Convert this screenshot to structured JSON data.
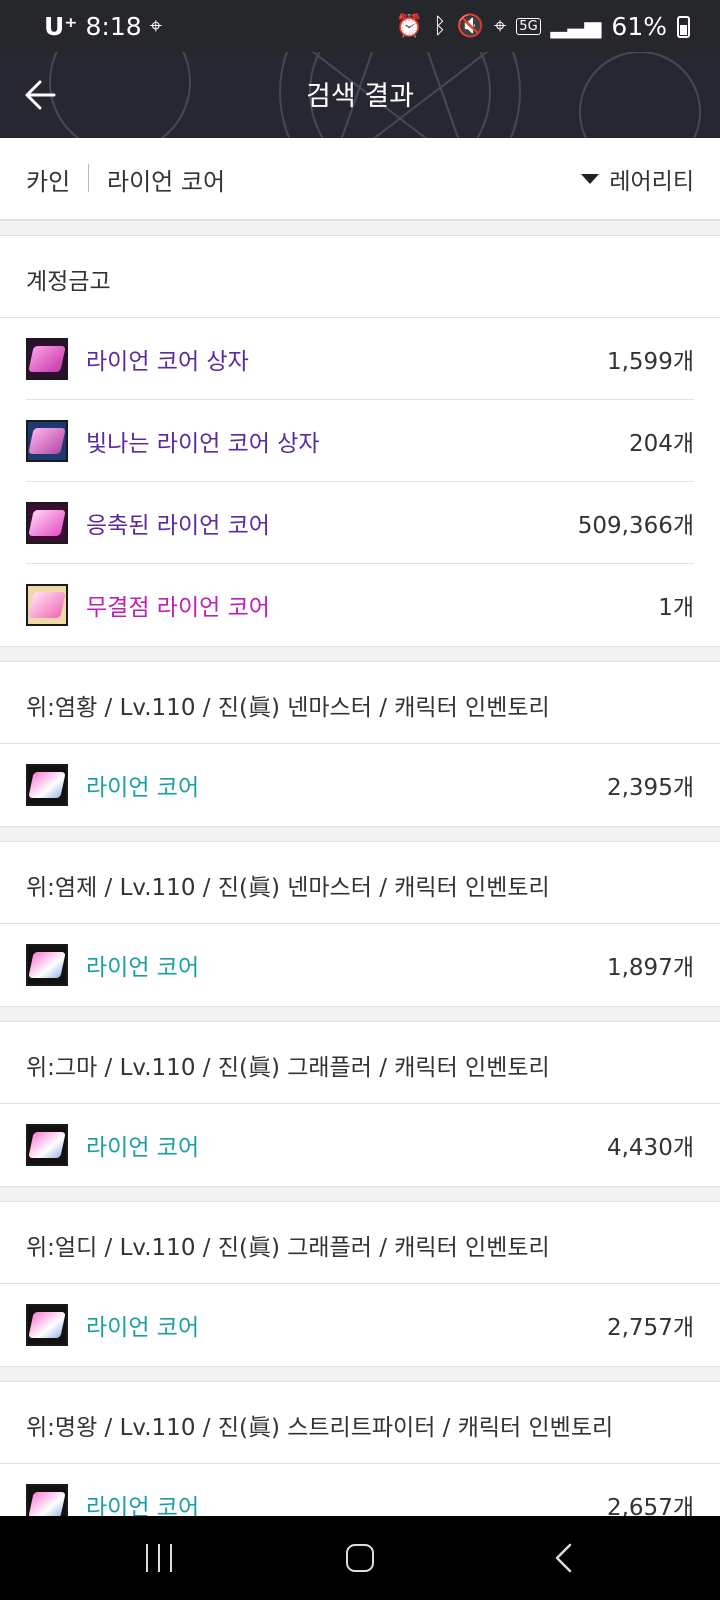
{
  "status_bar": {
    "carrier": "U⁺",
    "time": "8:18",
    "battery": "61%",
    "network": "5G"
  },
  "header": {
    "title": "검색 결과"
  },
  "search": {
    "server": "카인",
    "query": "라이언 코어",
    "sort_label": "레어리티"
  },
  "groups": [
    {
      "title": "계정금고",
      "items": [
        {
          "name": "라이언 코어 상자",
          "count": "1,599개",
          "color": "#5b2a9c",
          "icon": "pink-chest-icon"
        },
        {
          "name": "빛나는 라이언 코어 상자",
          "count": "204개",
          "color": "#5b2a9c",
          "icon": "shining-chest-icon"
        },
        {
          "name": "응축된 라이언 코어",
          "count": "509,366개",
          "color": "#5b2a9c",
          "icon": "condensed-core-icon"
        },
        {
          "name": "무결점 라이언 코어",
          "count": "1개",
          "color": "#c01fb6",
          "icon": "flawless-core-icon"
        }
      ]
    },
    {
      "title": "위:염황 / Lv.110 / 진(眞) 넨마스터 / 캐릭터 인벤토리",
      "items": [
        {
          "name": "라이언 코어",
          "count": "2,395개",
          "color": "#1a9fa0",
          "icon": "lion-core-icon"
        }
      ]
    },
    {
      "title": "위:염제 / Lv.110 / 진(眞) 넨마스터 / 캐릭터 인벤토리",
      "items": [
        {
          "name": "라이언 코어",
          "count": "1,897개",
          "color": "#1a9fa0",
          "icon": "lion-core-icon"
        }
      ]
    },
    {
      "title": "위:그마 / Lv.110 / 진(眞) 그래플러 / 캐릭터 인벤토리",
      "items": [
        {
          "name": "라이언 코어",
          "count": "4,430개",
          "color": "#1a9fa0",
          "icon": "lion-core-icon"
        }
      ]
    },
    {
      "title": "위:얼디 / Lv.110 / 진(眞) 그래플러 / 캐릭터 인벤토리",
      "items": [
        {
          "name": "라이언 코어",
          "count": "2,757개",
          "color": "#1a9fa0",
          "icon": "lion-core-icon"
        }
      ]
    },
    {
      "title": "위:명왕 / Lv.110 / 진(眞) 스트리트파이터 / 캐릭터 인벤토리",
      "items": [
        {
          "name": "라이언 코어",
          "count": "2,657개",
          "color": "#1a9fa0",
          "icon": "lion-core-icon"
        }
      ]
    }
  ]
}
